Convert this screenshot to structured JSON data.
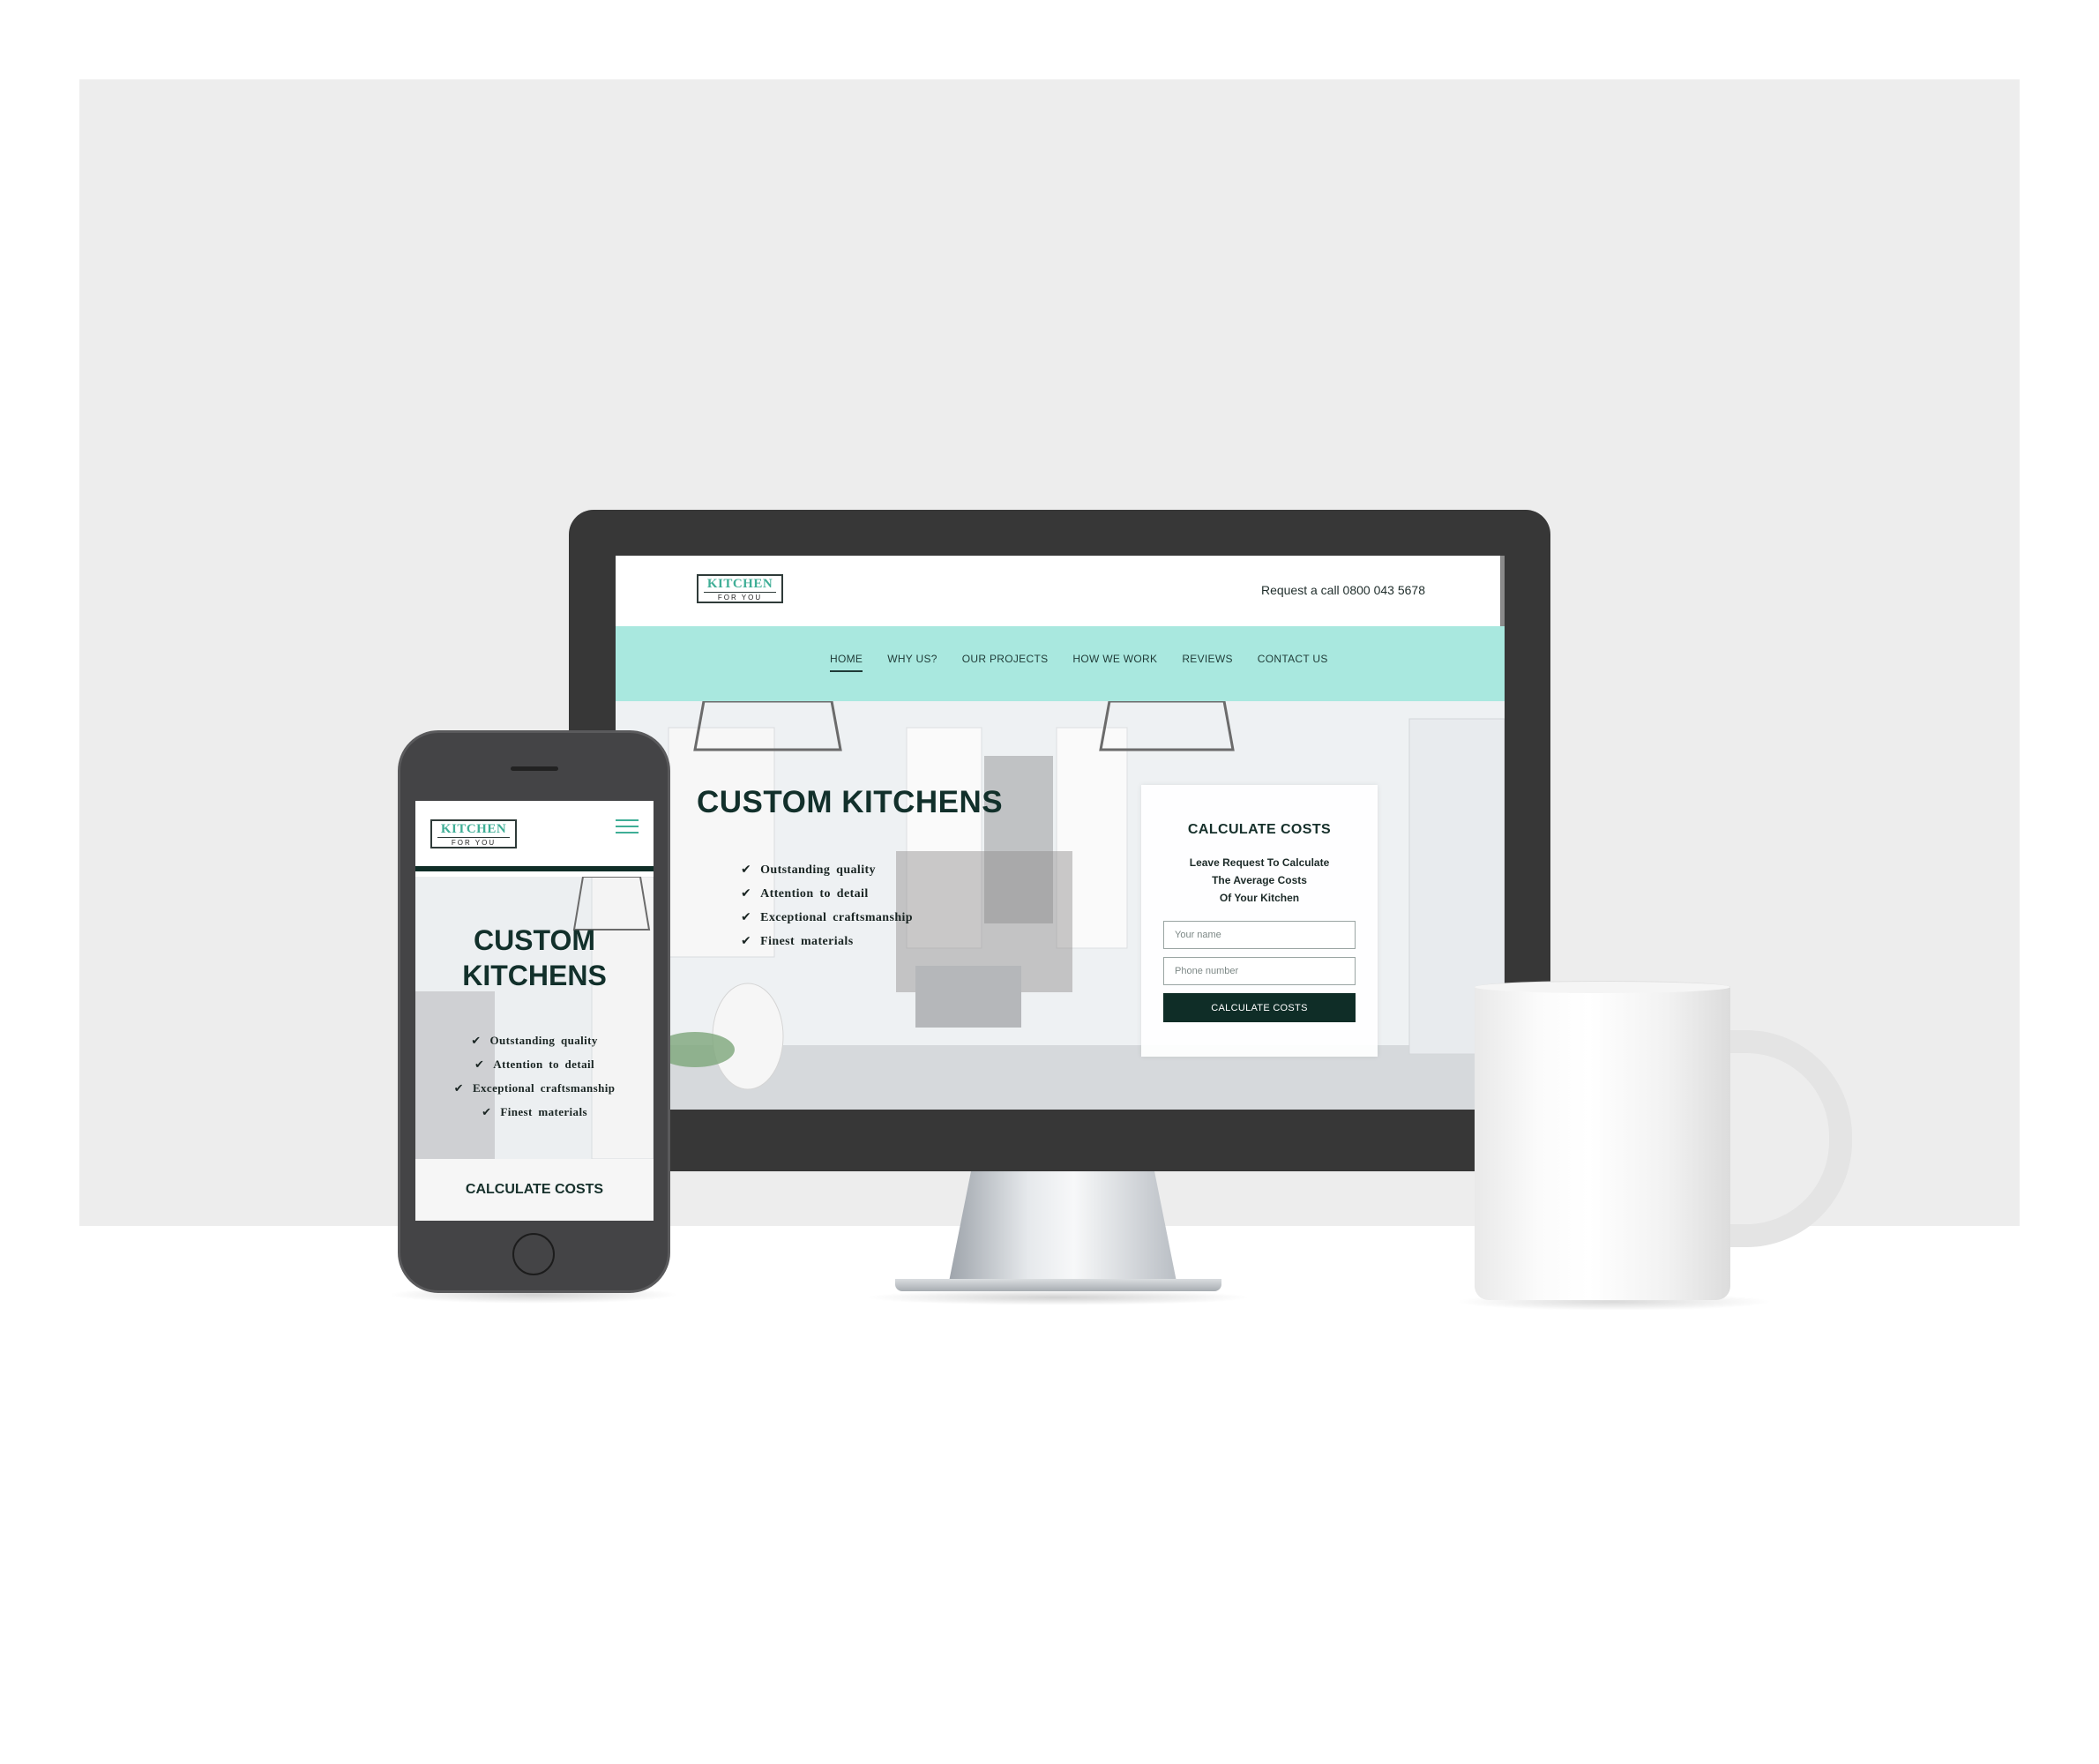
{
  "brand": {
    "logo_line1": "KITCHEN",
    "logo_line2": "FOR YOU"
  },
  "desktop": {
    "header": {
      "call_text": "Request a call 0800 043 5678"
    },
    "nav": {
      "items": [
        {
          "label": "HOME",
          "active": true
        },
        {
          "label": "WHY US?"
        },
        {
          "label": "OUR PROJECTS"
        },
        {
          "label": "HOW WE WORK"
        },
        {
          "label": "REVIEWS"
        },
        {
          "label": "CONTACT US"
        }
      ]
    },
    "hero": {
      "title": "CUSTOM KITCHENS",
      "features": [
        "Outstanding quality",
        "Attention to detail",
        "Exceptional craftsmanship",
        "Finest materials"
      ]
    },
    "calculator": {
      "title": "CALCULATE COSTS",
      "description_line1": "Leave Request To Calculate",
      "description_line2": "The Average Costs",
      "description_line3": "Of Your Kitchen",
      "name_placeholder": "Your name",
      "phone_placeholder": "Phone number",
      "submit_label": "CALCULATE COSTS"
    }
  },
  "mobile": {
    "hero": {
      "title_line1": "CUSTOM",
      "title_line2": "KITCHENS",
      "features": [
        "Outstanding quality",
        "Attention to detail",
        "Exceptional craftsmanship",
        "Finest materials"
      ]
    },
    "calculator_bar": "CALCULATE COSTS"
  },
  "icons": {
    "check": "check-icon",
    "menu": "hamburger-menu-icon"
  },
  "colors": {
    "nav_bg": "#a9e8df",
    "accent": "#3fae96",
    "dark_green": "#0f2d27",
    "backdrop": "#ededed",
    "device_frame": "#373737"
  }
}
